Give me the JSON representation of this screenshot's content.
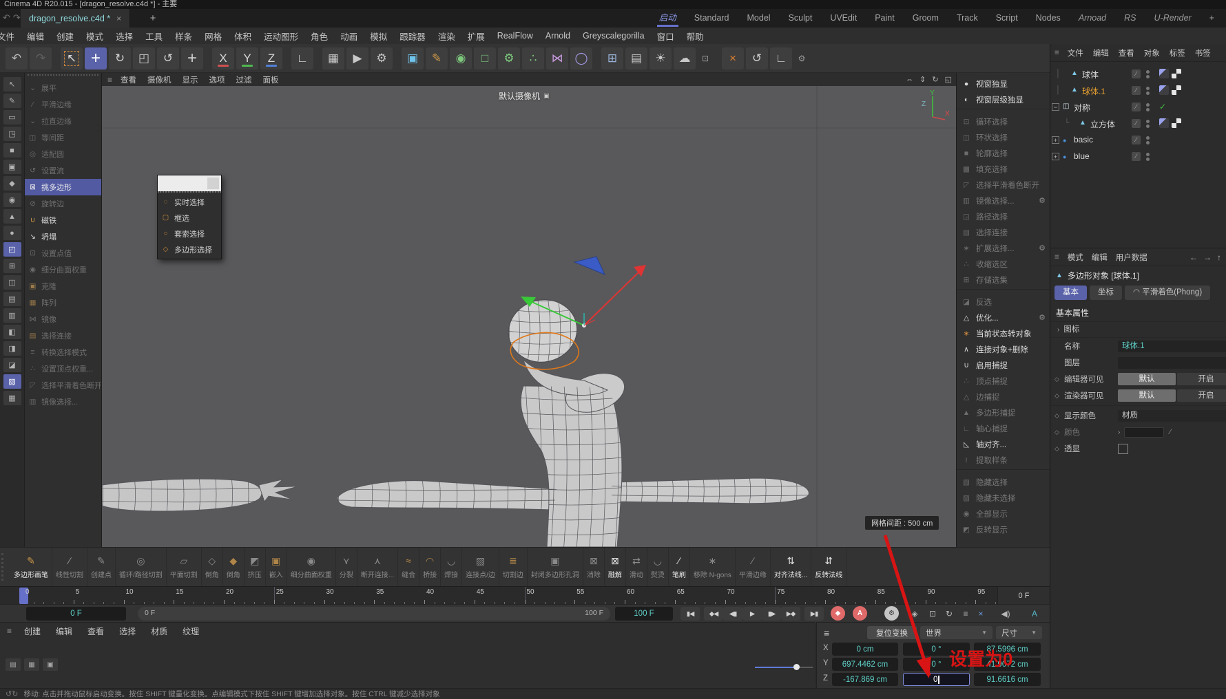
{
  "window": {
    "title": "Cinema 4D R20.015 - [dragon_resolve.c4d *] - 主要"
  },
  "tabbar": {
    "left_icons": [
      {
        "name": "undo-icon",
        "glyph": "↶"
      },
      {
        "name": "redo-icon",
        "glyph": "↷"
      }
    ],
    "doc_tab": "dragon_resolve.c4d *",
    "close_glyph": "×",
    "new_tab_glyph": "+",
    "workspaces": [
      {
        "label": "启动",
        "active": true
      },
      {
        "label": "Standard"
      },
      {
        "label": "Model"
      },
      {
        "label": "Sculpt"
      },
      {
        "label": "UVEdit"
      },
      {
        "label": "Paint"
      },
      {
        "label": "Groom"
      },
      {
        "label": "Track"
      },
      {
        "label": "Script"
      },
      {
        "label": "Nodes"
      },
      {
        "label": "Arnoad",
        "italic": true
      },
      {
        "label": "RS",
        "italic": true
      },
      {
        "label": "U-Render",
        "italic": true
      },
      {
        "label": "+",
        "is_add": true
      }
    ]
  },
  "menubar": [
    "文件",
    "编辑",
    "创建",
    "模式",
    "选择",
    "工具",
    "样条",
    "网格",
    "体积",
    "运动图形",
    "角色",
    "动画",
    "模拟",
    "跟踪器",
    "渲染",
    "扩展",
    "RealFlow",
    "Arnold",
    "Greyscalegorilla",
    "窗口",
    "帮助"
  ],
  "toolbar": {
    "groups": [
      [
        {
          "name": "undo-button",
          "glyph": "↶",
          "color": "#b8b8b8"
        },
        {
          "name": "redo-button",
          "glyph": "↷",
          "color": "#5f5f5f"
        }
      ],
      [
        {
          "name": "live-selection-tool",
          "glyph": "↖",
          "color": "#d8d8d8",
          "dashed": true
        },
        {
          "name": "move-tool",
          "glyph": "+",
          "color": "#ffffff",
          "active": true,
          "big": true
        },
        {
          "name": "rotate-tool",
          "glyph": "↻",
          "color": "#d0d0d0"
        },
        {
          "name": "scale-tool",
          "glyph": "◰",
          "color": "#d0d0d0"
        },
        {
          "name": "last-tool",
          "glyph": "↺",
          "color": "#d0d0d0"
        },
        {
          "name": "move-alt-tool",
          "glyph": "+",
          "color": "#d0d0d0",
          "big": true
        }
      ],
      [
        {
          "name": "axis-x-toggle",
          "glyph": "X",
          "color": "#d8d8d8",
          "underline": "#d05050"
        },
        {
          "name": "axis-y-toggle",
          "glyph": "Y",
          "color": "#d8d8d8",
          "underline": "#50b850"
        },
        {
          "name": "axis-z-toggle",
          "glyph": "Z",
          "color": "#d8d8d8",
          "underline": "#5080d8"
        }
      ],
      [
        {
          "name": "coord-system-button",
          "glyph": "∟",
          "color": "#d0d0d0"
        }
      ],
      [
        {
          "name": "render-view-button",
          "glyph": "▦",
          "color": "#c8c8c8"
        },
        {
          "name": "render-picture-viewer-button",
          "glyph": "▶",
          "color": "#c8c8c8"
        },
        {
          "name": "render-settings-button",
          "glyph": "⚙",
          "color": "#c8c8c8"
        }
      ],
      [
        {
          "name": "add-cube-button",
          "glyph": "▣",
          "color": "#6fc2ea"
        },
        {
          "name": "spline-pen-button",
          "glyph": "✎",
          "color": "#d29a4a"
        },
        {
          "name": "subdivision-surface-button",
          "glyph": "◉",
          "color": "#7dc87d"
        },
        {
          "name": "generator-button",
          "glyph": "□",
          "color": "#7dc87d"
        },
        {
          "name": "modeling-button",
          "glyph": "⚙",
          "color": "#7dc87d"
        },
        {
          "name": "array-button",
          "glyph": "∴",
          "color": "#7dc87d"
        },
        {
          "name": "symmetry-button",
          "glyph": "⋈",
          "color": "#c89ae0"
        },
        {
          "name": "spline-loop-button",
          "glyph": "◯",
          "color": "#a89ae8"
        }
      ],
      [
        {
          "name": "mograph-button",
          "glyph": "⊞",
          "color": "#9ab4d8"
        },
        {
          "name": "camera-button",
          "glyph": "▤",
          "color": "#c8c8c8"
        },
        {
          "name": "light-button",
          "glyph": "☀",
          "color": "#c8c8c8"
        },
        {
          "name": "environment-button",
          "glyph": "☁",
          "color": "#c8c8c8"
        },
        {
          "name": "open-window-button",
          "glyph": "⊡",
          "color": "#9a9a9a",
          "small": true
        }
      ],
      [
        {
          "name": "axis-center-button",
          "glyph": "×",
          "color": "#e08030"
        },
        {
          "name": "reset-psr-button",
          "glyph": "↺",
          "color": "#d0d0d0"
        },
        {
          "name": "workplane-button",
          "glyph": "∟",
          "color": "#d0d0d0"
        },
        {
          "name": "tool-options-button",
          "glyph": "⚙",
          "color": "#9a9a9a",
          "small": true
        }
      ]
    ]
  },
  "left_strip": {
    "icons": [
      {
        "glyph": "↖"
      },
      {
        "glyph": "✎"
      },
      {
        "glyph": "▭"
      },
      {
        "glyph": "◳"
      },
      {
        "glyph": "■"
      },
      {
        "glyph": "▣"
      },
      {
        "glyph": "◆"
      },
      {
        "glyph": "◉"
      },
      {
        "glyph": "▲"
      },
      {
        "glyph": "●"
      },
      {
        "glyph": "◰",
        "hl": true
      },
      {
        "glyph": "⊞"
      },
      {
        "glyph": "◫"
      },
      {
        "glyph": "▤"
      },
      {
        "glyph": "▥"
      },
      {
        "glyph": "◧"
      },
      {
        "glyph": "◨"
      },
      {
        "glyph": "◪"
      },
      {
        "glyph": "▧",
        "hl": true
      },
      {
        "glyph": "▦"
      }
    ]
  },
  "left_commands": {
    "items": [
      {
        "glyph": "⌄",
        "label": "展平",
        "state": "disabled"
      },
      {
        "glyph": "∕",
        "label": "平滑边缘",
        "state": "disabled"
      },
      {
        "glyph": "⌄",
        "label": "拉直边缘",
        "state": "disabled"
      },
      {
        "glyph": "◫",
        "label": "等间距",
        "state": "disabled"
      },
      {
        "glyph": "◎",
        "label": "适配圆",
        "state": "disabled"
      },
      {
        "glyph": "↺",
        "label": "设置流",
        "state": "disabled"
      },
      {
        "glyph": "⊠",
        "label": "挑多边形",
        "state": "selected"
      },
      {
        "glyph": "⊘",
        "label": "旋转边",
        "state": "disabled"
      },
      {
        "glyph": "∪",
        "label": "磁铁",
        "state": "normal",
        "c": "#d29a4a"
      },
      {
        "glyph": "↘",
        "label": "坍塌",
        "state": "normal",
        "c": "#e0e0e0"
      },
      {
        "glyph": "⊡",
        "label": "设置点值",
        "state": "disabled"
      },
      {
        "glyph": "◉",
        "label": "细分曲面权重",
        "state": "disabled"
      },
      {
        "glyph": "▣",
        "label": "克隆",
        "state": "disabled",
        "c": "#9a7a4a"
      },
      {
        "glyph": "▦",
        "label": "阵列",
        "state": "disabled",
        "c": "#9a7a4a"
      },
      {
        "glyph": "⋈",
        "label": "镜像",
        "state": "disabled"
      },
      {
        "glyph": "▤",
        "label": "选择连接",
        "state": "disabled",
        "c": "#9a7a4a"
      },
      {
        "glyph": "≡",
        "label": "转换选择模式",
        "state": "disabled"
      },
      {
        "glyph": "∴",
        "label": "设置顶点权重...",
        "state": "disabled"
      },
      {
        "glyph": "◸",
        "label": "选择平滑着色断开",
        "state": "disabled"
      },
      {
        "glyph": "▥",
        "label": "镜像选择...",
        "state": "disabled"
      }
    ]
  },
  "popup": {
    "items": [
      {
        "glyph": "◌",
        "label": "实时选择"
      },
      {
        "glyph": "▢",
        "label": "框选"
      },
      {
        "glyph": "○",
        "label": "套索选择"
      },
      {
        "glyph": "◇",
        "label": "多边形选择"
      }
    ]
  },
  "viewport": {
    "menu": [
      "查看",
      "摄像机",
      "显示",
      "选项",
      "过滤",
      "面板"
    ],
    "controls": [
      {
        "name": "pan-icon",
        "glyph": "⇔"
      },
      {
        "name": "dolly-icon",
        "glyph": "⇕"
      },
      {
        "name": "rotate-view-icon",
        "glyph": "↻"
      },
      {
        "name": "toggle-view-icon",
        "glyph": "◱"
      }
    ],
    "camera_label": "默认摄像机",
    "grid_label": "网格间距 : 500 cm",
    "axis": {
      "x": "X",
      "y": "Y",
      "z": "Z"
    }
  },
  "right_palette": {
    "items": [
      {
        "glyph": "●",
        "label": "视窗独显",
        "on": true
      },
      {
        "glyph": "◐",
        "label": "视窗层级独显",
        "on": true,
        "sep_after": true
      },
      {
        "glyph": "⊡",
        "label": "循环选择",
        "on": false
      },
      {
        "glyph": "◫",
        "label": "环状选择",
        "on": false
      },
      {
        "glyph": "■",
        "label": "轮廓选择",
        "on": false
      },
      {
        "glyph": "▩",
        "label": "填充选择",
        "on": false
      },
      {
        "glyph": "◸",
        "label": "选择平滑着色断开",
        "on": false
      },
      {
        "glyph": "▥",
        "label": "镜像选择...",
        "on": false,
        "gear": true
      },
      {
        "glyph": "◲",
        "label": "路径选择",
        "on": false
      },
      {
        "glyph": "▤",
        "label": "选择连接",
        "on": false
      },
      {
        "glyph": "∗",
        "label": "扩展选择...",
        "on": false,
        "gear": true
      },
      {
        "glyph": "∴",
        "label": "收缩选区",
        "on": false
      },
      {
        "glyph": "⊞",
        "label": "存储选集",
        "on": false,
        "sep_after": true
      },
      {
        "glyph": "◪",
        "label": "反选",
        "on": false
      },
      {
        "glyph": "△",
        "label": "优化...",
        "on": true,
        "gear": true
      },
      {
        "glyph": "∗",
        "label": "当前状态转对象",
        "on": true,
        "c": "#d89040"
      },
      {
        "glyph": "∧",
        "label": "连接对象+删除",
        "on": true
      },
      {
        "glyph": "∪",
        "label": "启用捕捉",
        "on": true
      },
      {
        "glyph": "∴",
        "label": "顶点捕捉",
        "on": false
      },
      {
        "glyph": "△",
        "label": "边捕捉",
        "on": false
      },
      {
        "glyph": "▲",
        "label": "多边形捕捉",
        "on": false
      },
      {
        "glyph": "∟",
        "label": "轴心捕捉",
        "on": false
      },
      {
        "glyph": "◺",
        "label": "轴对齐...",
        "on": true
      },
      {
        "glyph": "≀",
        "label": "提取样条",
        "on": false,
        "sep_after": true
      },
      {
        "glyph": "▧",
        "label": "隐藏选择",
        "on": false
      },
      {
        "glyph": "▨",
        "label": "隐藏未选择",
        "on": false
      },
      {
        "glyph": "◉",
        "label": "全部显示",
        "on": false
      },
      {
        "glyph": "◩",
        "label": "反转显示",
        "on": false
      }
    ]
  },
  "object_manager": {
    "menu_icon": "≡",
    "menu": [
      "文件",
      "编辑",
      "查看",
      "对象",
      "标签",
      "书签"
    ],
    "objects": [
      {
        "name": "球体",
        "color": "#d8d8d8",
        "icon": "poly",
        "depth": 1,
        "tags": [
          "phong",
          "texture"
        ]
      },
      {
        "name": "球体.1",
        "color": "#e8a030",
        "icon": "poly",
        "depth": 1,
        "tags": [
          "phong",
          "texture"
        ]
      },
      {
        "name": "对称",
        "color": "#d8d8d8",
        "icon": "symmetry",
        "depth": 0,
        "expander": "minus",
        "check": true
      },
      {
        "name": "立方体",
        "color": "#d8d8d8",
        "icon": "poly",
        "depth": 2,
        "tags": [
          "phong",
          "texture"
        ]
      },
      {
        "name": "basic",
        "color": "#d8d8d8",
        "icon": "layer",
        "depth": 0,
        "expander": "plus"
      },
      {
        "name": "blue",
        "color": "#d8d8d8",
        "icon": "layer",
        "depth": 0,
        "expander": "plus"
      }
    ]
  },
  "attributes": {
    "menu_icon": "≡",
    "menu": [
      "模式",
      "编辑",
      "用户数据"
    ],
    "nav_icons": [
      "←",
      "→",
      "↑"
    ],
    "title": "多边形对象 [球体.1]",
    "tabs": [
      {
        "label": "基本",
        "active": true
      },
      {
        "label": "坐标"
      },
      {
        "label": "平滑着色(Phong)",
        "icon": "◠"
      }
    ],
    "section": "基本属性",
    "icon_row": "图标",
    "rows": [
      {
        "type": "input",
        "label": "名称",
        "value": "球体.1"
      },
      {
        "type": "input",
        "label": "图层",
        "value": ""
      },
      {
        "type": "btn2",
        "label": "编辑器可见",
        "a": "默认",
        "b": "开启",
        "diamond": true
      },
      {
        "type": "btn2",
        "label": "渲染器可见",
        "a": "默认",
        "b": "开启",
        "diamond": true,
        "sep_after": true
      },
      {
        "type": "dropdown",
        "label": "显示颜色",
        "value": "材质",
        "diamond": true
      },
      {
        "type": "color",
        "label": "颜色",
        "diamond": true,
        "dim": true
      },
      {
        "type": "checkbox",
        "label": "透显",
        "diamond": true
      }
    ]
  },
  "bottom_toolbar": {
    "items": [
      {
        "label": "多边形画笔",
        "glyph": "✎",
        "c": "#d29a4a",
        "active": true
      },
      {
        "label": "线性切割",
        "glyph": "∕",
        "c": "#9a9a9a"
      },
      {
        "label": "创建点",
        "glyph": "✎",
        "c": "#8a8a8a"
      },
      {
        "label": "循环/路径切割",
        "glyph": "◎",
        "c": "#8a8a8a"
      },
      {
        "label": "平面切割",
        "glyph": "▱",
        "c": "#8a8a8a"
      },
      {
        "label": "倒角",
        "glyph": "◇",
        "c": "#8a8a8a"
      },
      {
        "label": "倒角",
        "glyph": "◆",
        "c": "#b08648"
      },
      {
        "label": "挤压",
        "glyph": "◩",
        "c": "#8a8a8a"
      },
      {
        "label": "嵌入",
        "glyph": "▣",
        "c": "#b08648"
      },
      {
        "label": "细分曲面权重",
        "glyph": "◉",
        "c": "#8a8a8a"
      },
      {
        "label": "分裂",
        "glyph": "⋎",
        "c": "#8a8a8a"
      },
      {
        "label": "断开连接...",
        "glyph": "⋏",
        "c": "#8a8a8a"
      },
      {
        "label": "缝合",
        "glyph": "≈",
        "c": "#b08648"
      },
      {
        "label": "桥接",
        "glyph": "◠",
        "c": "#b08648"
      },
      {
        "label": "焊接",
        "glyph": "◡",
        "c": "#8a8a8a"
      },
      {
        "label": "连接点/边",
        "glyph": "▨",
        "c": "#8a8a8a"
      },
      {
        "label": "切割边",
        "glyph": "≣",
        "c": "#b08648"
      },
      {
        "label": "封闭多边形孔洞",
        "glyph": "▣",
        "c": "#8a8a8a"
      },
      {
        "label": "消除",
        "glyph": "⊠",
        "c": "#8a8a8a"
      },
      {
        "label": "融解",
        "glyph": "⊠",
        "c": "#e0e0e0",
        "active": true
      },
      {
        "label": "滑动",
        "glyph": "⇄",
        "c": "#8a8a8a"
      },
      {
        "label": "熨烫",
        "glyph": "◡",
        "c": "#8a8a8a"
      },
      {
        "label": "笔刷",
        "glyph": "∕",
        "c": "#e0e0e0",
        "active": true
      },
      {
        "label": "移除 N-gons",
        "glyph": "∗",
        "c": "#8a8a8a"
      },
      {
        "label": "平滑边缘",
        "glyph": "∕",
        "c": "#8a8a8a"
      },
      {
        "label": "对齐法线...",
        "glyph": "⇅",
        "c": "#e0e0e0",
        "active": true
      },
      {
        "label": "反转法线",
        "glyph": "⇵",
        "c": "#e0e0e0",
        "active": true
      }
    ]
  },
  "timeline": {
    "tick_labels": [
      "0",
      "5",
      "10",
      "15",
      "20",
      "25",
      "30",
      "35",
      "40",
      "45",
      "50",
      "55",
      "60",
      "65",
      "70",
      "75",
      "80",
      "85",
      "90",
      "95"
    ],
    "current_right": "0 F"
  },
  "transport": {
    "current": "0 F",
    "range_start": "0 F",
    "range_end": "100 F",
    "end_frame": "100 F",
    "buttons": [
      {
        "name": "go-to-start-button",
        "glyph": "▮◀",
        "kind": "btn"
      },
      {
        "name": "prev-key-button",
        "glyph": "◆◀",
        "kind": "btn"
      },
      {
        "name": "prev-frame-button",
        "glyph": "◀▮",
        "kind": "btn"
      },
      {
        "name": "play-button",
        "glyph": "▶",
        "kind": "btn"
      },
      {
        "name": "next-frame-button",
        "glyph": "▮▶",
        "kind": "btn"
      },
      {
        "name": "next-key-button",
        "glyph": "▶◆",
        "kind": "btn"
      },
      {
        "name": "go-to-end-button",
        "glyph": "▶▮",
        "kind": "btn"
      },
      {
        "name": "record-keyframe-button",
        "glyph": "◆",
        "kind": "circle",
        "bg": "#e06a6a"
      },
      {
        "name": "autokey-button",
        "glyph": "A",
        "kind": "circle",
        "bg": "#e06a6a"
      },
      {
        "name": "keyframe-settings-button",
        "glyph": "⚙",
        "kind": "circle",
        "bg": "#c6c6c6",
        "fg": "#333"
      },
      {
        "name": "key-position-toggle",
        "glyph": "◈",
        "kind": "plain"
      },
      {
        "name": "key-scale-toggle",
        "glyph": "⊡",
        "kind": "plain"
      },
      {
        "name": "key-rotation-toggle",
        "glyph": "↻",
        "kind": "plain"
      },
      {
        "name": "key-parameter-toggle",
        "glyph": "≡",
        "kind": "plain"
      },
      {
        "name": "key-pla-toggle",
        "glyph": "×",
        "kind": "plain",
        "fg": "#6a9ae0"
      },
      {
        "name": "sound-toggle",
        "glyph": "◀)",
        "kind": "plain"
      },
      {
        "name": "solo-toggle",
        "glyph": "A",
        "kind": "plain",
        "fg": "#54b8c8"
      }
    ]
  },
  "material_manager": {
    "menu_icon": "≡",
    "menu": [
      "创建",
      "编辑",
      "查看",
      "选择",
      "材质",
      "纹理"
    ],
    "view_icons": [
      {
        "name": "material-grid-view-icon",
        "glyph": "▤"
      },
      {
        "name": "material-list-view-icon",
        "glyph": "▦"
      },
      {
        "name": "material-compact-view-icon",
        "glyph": "▣"
      }
    ]
  },
  "coordinates": {
    "menu_icon": "≡",
    "reset_label": "复位变换",
    "space_label": "世界",
    "size_label": "尺寸",
    "caret_glyph": "▼",
    "rows": [
      {
        "axis": "X",
        "pos": "0 cm",
        "rot": "0 °",
        "size": "87.5996 cm"
      },
      {
        "axis": "Y",
        "pos": "697.4462 cm",
        "rot": "0 °",
        "size": "41.9072 cm"
      },
      {
        "axis": "Z",
        "pos": "-167.869 cm",
        "rot": "0",
        "size": "91.6616 cm",
        "rot_editing": true
      }
    ]
  },
  "annotation": {
    "text": "设置为0",
    "color": "#d81414"
  },
  "statusbar": {
    "icons": [
      "↺",
      "↻"
    ],
    "text": "移动: 点击并拖动鼠标启动变换。按住 SHIFT 键量化变换。点编辑模式下按住 SHIFT 键增加选择对象。按住 CTRL 键减少选择对象"
  }
}
